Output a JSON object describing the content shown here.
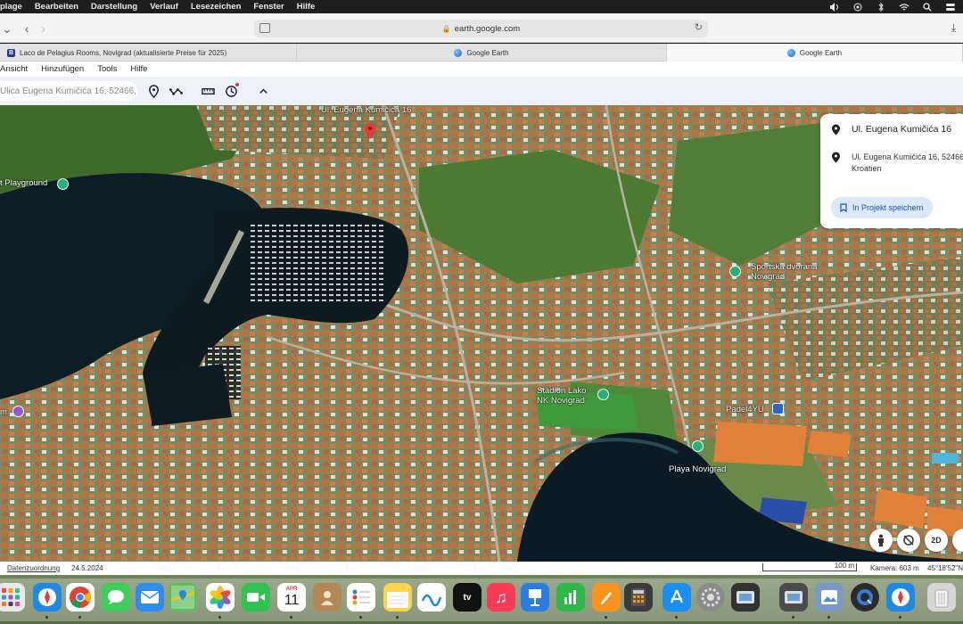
{
  "menubar": {
    "items": [
      "plage",
      "Bearbeiten",
      "Darstellung",
      "Verlauf",
      "Lesezeichen",
      "Fenster",
      "Hilfe"
    ]
  },
  "browser": {
    "url": "earth.google.com",
    "tabs": [
      {
        "label": "Laco de Pelagius Rooms, Novigrad (aktualisierte Preise für 2025)",
        "favicon": "booking-icon"
      },
      {
        "label": "Google Earth",
        "favicon": "google-earth-icon"
      },
      {
        "label": "Google Earth",
        "favicon": "google-earth-icon"
      }
    ]
  },
  "earth_menu": [
    "Ansicht",
    "Hinzufügen",
    "Tools",
    "Hilfe"
  ],
  "search": {
    "value": "Ulica Eugena Kumičića 16, 52466,"
  },
  "map": {
    "labels": {
      "pin": "Ul. Eugena Kumičića 16",
      "playground": "t Playground",
      "sportska": "Sportska dvorana\nNovigrad",
      "stadion": "Stadion Lako\nNK Novigrad",
      "padel": "Padel4YU",
      "playa": "Playa Novigrad",
      "museum": "m"
    },
    "controls": [
      "person-icon",
      "compass-off-icon",
      "2D"
    ]
  },
  "info_card": {
    "title": "Ul. Eugena Kumičića 16",
    "address_line1": "Ul. Eugena Kumičića 16, 52466",
    "address_line2": "Kroatien",
    "save_label": "In Projekt speichern"
  },
  "statusbar": {
    "attribution": "Datenzuordnung",
    "date": "24.5.2024",
    "scale": "100 m",
    "camera": "Kamera: 603 m",
    "coords": "45°18'52\"N"
  },
  "dock": {
    "apps": [
      {
        "name": "launchpad",
        "color": "#e8e8e8"
      },
      {
        "name": "safari",
        "color": "#1e88e5"
      },
      {
        "name": "chrome",
        "color": "#ffffff"
      },
      {
        "name": "messages",
        "color": "#3ecf5a"
      },
      {
        "name": "mail",
        "color": "#2f8df0"
      },
      {
        "name": "maps",
        "color": "#5fbf5f"
      },
      {
        "name": "photos",
        "color": "#ffffff"
      },
      {
        "name": "facetime",
        "color": "#2fc24f"
      },
      {
        "name": "calendar",
        "color": "#ffffff"
      },
      {
        "name": "contacts",
        "color": "#b48757"
      },
      {
        "name": "reminders",
        "color": "#ffffff"
      },
      {
        "name": "notes",
        "color": "#fbd54a"
      },
      {
        "name": "freeform",
        "color": "#ffffff"
      },
      {
        "name": "tv",
        "color": "#111111"
      },
      {
        "name": "music",
        "color": "#fa3b55"
      },
      {
        "name": "keynote",
        "color": "#2a7de1"
      },
      {
        "name": "numbers",
        "color": "#2fb84a"
      },
      {
        "name": "pages",
        "color": "#f7931e"
      },
      {
        "name": "calculator",
        "color": "#3a3a3a"
      },
      {
        "name": "app-store",
        "color": "#1b8ef2"
      },
      {
        "name": "system-settings",
        "color": "#8a8a8a"
      },
      {
        "name": "scanner",
        "color": "#333333"
      },
      {
        "name": "screenshot",
        "color": "#4b4b4b"
      },
      {
        "name": "preview",
        "color": "#7a99c4"
      },
      {
        "name": "quicktime",
        "color": "#2a2a2a"
      },
      {
        "name": "safari-2",
        "color": "#1e88e5"
      },
      {
        "name": "trash",
        "color": "#d6d6d6"
      }
    ],
    "calendar_month": "APR",
    "calendar_day": "11",
    "tv_label": "tv"
  }
}
